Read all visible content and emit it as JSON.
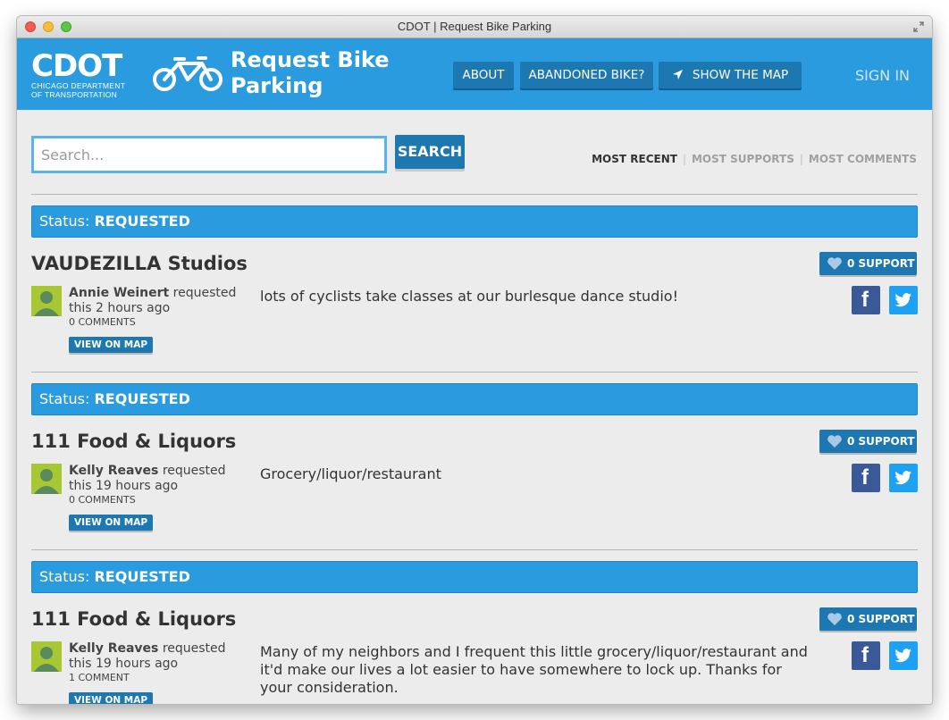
{
  "window": {
    "title": "CDOT | Request Bike Parking"
  },
  "header": {
    "logo_text": "CDOT",
    "logo_subtitle_line1": "CHICAGO DEPARTMENT",
    "logo_subtitle_line2": "OF TRANSPORTATION",
    "app_title_line1": "Request Bike",
    "app_title_line2": "Parking",
    "nav": {
      "about": "ABOUT",
      "abandoned": "ABANDONED BIKE?",
      "show_map": "SHOW THE MAP"
    },
    "sign_in": "SIGN IN"
  },
  "search": {
    "placeholder": "Search...",
    "button": "SEARCH"
  },
  "sort": {
    "most_recent": "MOST RECENT",
    "most_supports": "MOST SUPPORTS",
    "most_comments": "MOST COMMENTS",
    "active": "MOST RECENT"
  },
  "colors": {
    "header_blue": "#2b9be0",
    "button_blue": "#1d78b2",
    "facebook": "#3b5998",
    "twitter": "#1da1f2",
    "avatar": "#a7c832"
  },
  "requests": [
    {
      "status_label": "Status:",
      "status": "REQUESTED",
      "title": "VAUDEZILLA Studios",
      "user": "Annie Weinert",
      "action": " requested this 2 hours ago",
      "comments": "0 COMMENTS",
      "view_map": "VIEW ON MAP",
      "description": "lots of cyclists take classes at our burlesque dance studio!",
      "support": "0 SUPPORT"
    },
    {
      "status_label": "Status:",
      "status": "REQUESTED",
      "title": "111 Food & Liquors",
      "user": "Kelly Reaves",
      "action": " requested this 19 hours ago",
      "comments": "0 COMMENTS",
      "view_map": "VIEW ON MAP",
      "description": "Grocery/liquor/restaurant",
      "support": "0 SUPPORT"
    },
    {
      "status_label": "Status:",
      "status": "REQUESTED",
      "title": "111 Food & Liquors",
      "user": "Kelly Reaves",
      "action": " requested this 19 hours ago",
      "comments": "1 COMMENT",
      "view_map": "VIEW ON MAP",
      "description": "Many of my neighbors and I frequent this little grocery/liquor/restaurant and it'd make our lives a lot easier to have somewhere to lock up. Thanks for your consideration.",
      "support": "0 SUPPORT"
    }
  ]
}
